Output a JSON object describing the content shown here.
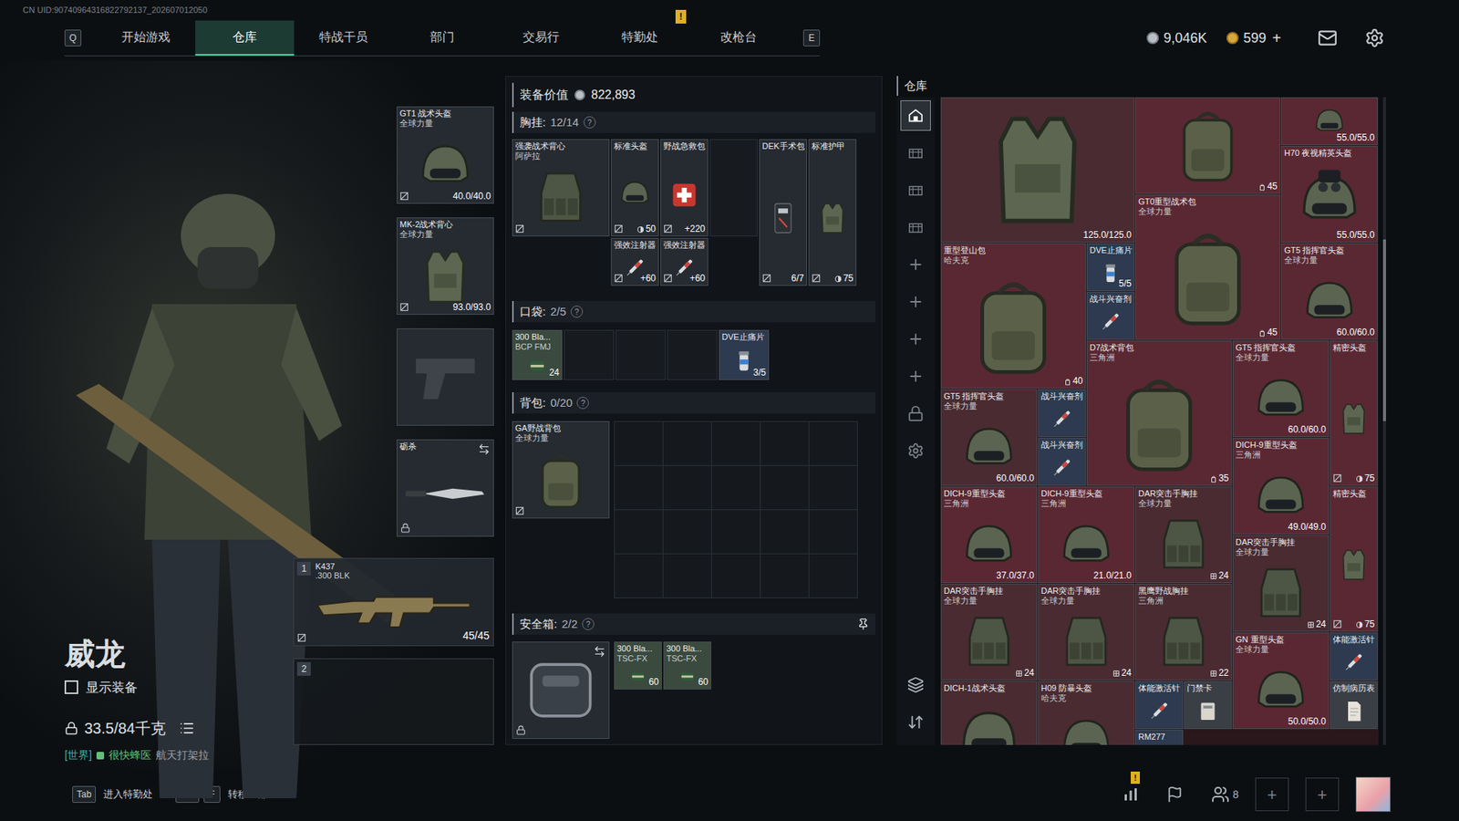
{
  "uid": "CN UID:90740964316822792137_202607012050",
  "nav": {
    "prev_key": "Q",
    "next_key": "E",
    "alert_mark": "!",
    "tabs": [
      {
        "label": "开始游戏",
        "selected": false,
        "alert": false
      },
      {
        "label": "仓库",
        "selected": true,
        "alert": false
      },
      {
        "label": "特战干员",
        "selected": false,
        "alert": false
      },
      {
        "label": "部门",
        "selected": false,
        "alert": false
      },
      {
        "label": "交易行",
        "selected": false,
        "alert": false
      },
      {
        "label": "特勤处",
        "selected": false,
        "alert": true
      },
      {
        "label": "改枪台",
        "selected": false,
        "alert": false
      }
    ]
  },
  "currency": {
    "coins": "9,046K",
    "gold": "599",
    "add": "+"
  },
  "character": {
    "name": "威龙",
    "show_gear": {
      "label": "显示装备",
      "checked": false
    },
    "weight": "33.5/84千克",
    "chat": {
      "channel": "[世界]",
      "user": "很快蜂医",
      "message": "航天打架拉"
    }
  },
  "gear_slots": [
    {
      "kind": "helmet",
      "name": "GT1 战术头盔",
      "faction": "全球力量",
      "value": "40.0/40.0",
      "bound": true,
      "empty": false,
      "locked": false,
      "swappable": false
    },
    {
      "kind": "armor",
      "name": "MK-2战术背心",
      "faction": "全球力量",
      "value": "93.0/93.0",
      "bound": true,
      "empty": false,
      "locked": false,
      "swappable": false
    },
    {
      "kind": "pistol",
      "empty": true,
      "bound": false,
      "locked": false,
      "swappable": false
    },
    {
      "kind": "knife",
      "name": "砺杀",
      "empty": false,
      "bound": false,
      "locked": true,
      "swappable": true
    }
  ],
  "weapons": [
    {
      "slot": "1",
      "name": "K437",
      "caliber": ".300 BLK",
      "ammo": "45/45",
      "bound": true,
      "empty": false
    },
    {
      "slot": "2",
      "empty": true,
      "bound": false
    }
  ],
  "loadout": {
    "value_label": "装备价值",
    "value": "822,893",
    "rig": {
      "title": "胸挂:",
      "count": "12/14",
      "help": "?",
      "container": {
        "kind": "rig",
        "name": "强袭战术背心",
        "faction": "阿萨拉",
        "bound": true
      },
      "items": [
        {
          "kind": "helmet",
          "name": "标准头盔",
          "value": "50",
          "badge": "shield",
          "bound": true
        },
        {
          "kind": "medkit",
          "name": "野战急救包",
          "value": "+220",
          "badge": "none",
          "bound": true
        },
        {
          "kind": "empty"
        },
        {
          "kind": "surgery",
          "name": "DEK手术包",
          "value": "6/7",
          "badge": "none",
          "bound": true
        },
        {
          "kind": "armor",
          "name": "标准护甲",
          "value": "75",
          "badge": "shield",
          "bound": true
        },
        {
          "kind": "stim",
          "name": "强效注射器",
          "value": "+60",
          "badge": "none",
          "bound": true
        },
        {
          "kind": "stim",
          "name": "强效注射器",
          "value": "+60",
          "badge": "none",
          "bound": true
        }
      ]
    },
    "pockets": {
      "title": "口袋:",
      "count": "2/5",
      "help": "?",
      "items": [
        {
          "kind": "ammo",
          "name": "300 Bla...",
          "faction": "BCP FMJ",
          "value": "24",
          "badge": "none",
          "bound": false,
          "color": "#3a4a3e"
        },
        {
          "kind": "empty"
        },
        {
          "kind": "empty"
        },
        {
          "kind": "empty"
        },
        {
          "kind": "pill",
          "name": "DVE止痛片",
          "value": "3/5",
          "badge": "none",
          "bound": false,
          "color": "#2d3a4f"
        }
      ]
    },
    "backpack": {
      "title": "背包:",
      "count": "0/20",
      "help": "?",
      "container": {
        "kind": "backpack",
        "name": "GA野战背包",
        "faction": "全球力量",
        "bound": true
      },
      "cells": 20
    },
    "safe": {
      "title": "安全箱:",
      "count": "2/2",
      "help": "?",
      "pinned": true,
      "container": {
        "kind": "safe",
        "locked": true,
        "swappable": true
      },
      "items": [
        {
          "kind": "ammo",
          "name": "300 Bla...",
          "faction": "TSC-FX",
          "value": "60",
          "badge": "none",
          "bound": false,
          "color": "#3a4a3e"
        },
        {
          "kind": "ammo",
          "name": "300 Bla...",
          "faction": "TSC-FX",
          "value": "60",
          "badge": "none",
          "bound": false,
          "color": "#3a4a3e"
        }
      ]
    }
  },
  "warehouse": {
    "title": "仓库",
    "sidebar": [
      {
        "kind": "home",
        "selected": true
      },
      {
        "kind": "box",
        "selected": false
      },
      {
        "kind": "box",
        "selected": false
      },
      {
        "kind": "box",
        "selected": false
      },
      {
        "kind": "add",
        "selected": false
      },
      {
        "kind": "add",
        "selected": false
      },
      {
        "kind": "add",
        "selected": false
      },
      {
        "kind": "add",
        "selected": false
      },
      {
        "kind": "lock",
        "selected": false
      },
      {
        "kind": "settings",
        "selected": false
      }
    ],
    "tools": [
      {
        "kind": "layers"
      },
      {
        "kind": "sort"
      }
    ],
    "scroll": {
      "offset": 0.22,
      "size": 0.28
    },
    "items": [
      {
        "kind": "armor",
        "value": "125.0/125.0",
        "badge": "none",
        "bound": false,
        "color": "#4a2b31"
      },
      {
        "kind": "backpack",
        "value": "45",
        "badge": "bag",
        "bound": false,
        "color": "#5a2832"
      },
      {
        "kind": "helmet",
        "value": "55.0/55.0",
        "badge": "none",
        "bound": false,
        "color": "#5a2832"
      },
      {
        "kind": "nvg",
        "name": "H70 夜视精英头盔",
        "value": "55.0/55.0",
        "badge": "none",
        "bound": false,
        "color": "#5a2832"
      },
      {
        "kind": "backpack",
        "name": "GT0重型战术包",
        "faction": "全球力量",
        "value": "45",
        "badge": "bag",
        "bound": false,
        "color": "#5a2832"
      },
      {
        "kind": "backpack",
        "name": "重型登山包",
        "faction": "哈夫克",
        "value": "40",
        "badge": "bag",
        "bound": false,
        "color": "#5a2832"
      },
      {
        "kind": "pill",
        "name": "DVE止痛片",
        "value": "5/5",
        "badge": "none",
        "bound": false,
        "color": "#2d3a4f"
      },
      {
        "kind": "stim",
        "name": "战斗兴奋剂",
        "bound": false,
        "color": "#2d3a4f"
      },
      {
        "kind": "helmet",
        "name": "GT5 指挥官头盔",
        "faction": "全球力量",
        "value": "60.0/60.0",
        "badge": "none",
        "bound": false,
        "color": "#5a2832"
      },
      {
        "kind": "backpack",
        "name": "D7战术背包",
        "faction": "三角洲",
        "value": "35",
        "badge": "bag",
        "bound": false,
        "color": "#5a2832"
      },
      {
        "kind": "helmet",
        "name": "GT5 指挥官头盔",
        "faction": "全球力量",
        "value": "60.0/60.0",
        "badge": "none",
        "bound": false,
        "color": "#5a2832"
      },
      {
        "kind": "armor",
        "name": "精密头盔",
        "value": "75",
        "badge": "shield",
        "bound": true,
        "color": "#5a2832"
      },
      {
        "kind": "helmet",
        "name": "GT5 指挥官头盔",
        "faction": "全球力量",
        "value": "60.0/60.0",
        "badge": "none",
        "bound": false,
        "color": "#4a2b31"
      },
      {
        "kind": "stim",
        "name": "战斗兴奋剂",
        "bound": false,
        "color": "#2d3a4f"
      },
      {
        "kind": "stim",
        "name": "战斗兴奋剂",
        "bound": false,
        "color": "#2d3a4f"
      },
      {
        "kind": "helmet",
        "name": "DICH-9重型头盔",
        "faction": "三角洲",
        "value": "49.0/49.0",
        "badge": "none",
        "bound": false,
        "color": "#5a2832"
      },
      {
        "kind": "helmet",
        "name": "DICH-9重型头盔",
        "faction": "三角洲",
        "value": "37.0/37.0",
        "badge": "none",
        "bound": false,
        "color": "#5a2832"
      },
      {
        "kind": "helmet",
        "name": "DICH-9重型头盔",
        "faction": "三角洲",
        "value": "21.0/21.0",
        "badge": "none",
        "bound": false,
        "color": "#5a2832"
      },
      {
        "kind": "rig",
        "name": "DAR突击手胸挂",
        "faction": "全球力量",
        "value": "24",
        "badge": "grid",
        "bound": false,
        "color": "#4a2b31"
      },
      {
        "kind": "armor",
        "name": "精密头盔",
        "value": "75",
        "badge": "shield",
        "bound": true,
        "color": "#5a2832"
      },
      {
        "kind": "rig",
        "name": "DAR突击手胸挂",
        "faction": "全球力量",
        "value": "24",
        "badge": "grid",
        "bound": false,
        "color": "#4a2b31"
      },
      {
        "kind": "rig",
        "name": "DAR突击手胸挂",
        "faction": "全球力量",
        "value": "24",
        "badge": "grid",
        "bound": false,
        "color": "#4a2b31"
      },
      {
        "kind": "rig",
        "name": "DAR突击手胸挂",
        "faction": "全球力量",
        "value": "24",
        "badge": "grid",
        "bound": false,
        "color": "#4a2b31"
      },
      {
        "kind": "rig",
        "name": "黑鹰野战胸挂",
        "faction": "三角洲",
        "value": "22",
        "badge": "grid",
        "bound": false,
        "color": "#4a2b31"
      },
      {
        "kind": "helmet",
        "name": "GN 重型头盔",
        "faction": "全球力量",
        "value": "50.0/50.0",
        "badge": "none",
        "bound": false,
        "color": "#5a2832"
      },
      {
        "kind": "stim",
        "name": "体能激活针",
        "bound": false,
        "color": "#2d3a4f"
      },
      {
        "kind": "helmet",
        "name": "DICH-1战术头盔",
        "bound": false,
        "color": "#4a2b31"
      },
      {
        "kind": "helmet",
        "name": "H09 防暴头盔",
        "faction": "哈夫克",
        "bound": false,
        "color": "#4a2b31"
      },
      {
        "kind": "stim",
        "name": "体能激活针",
        "bound": false,
        "color": "#2d3a4f"
      },
      {
        "kind": "ammo",
        "name": "RM277",
        "bound": false,
        "color": "#2d3a4f"
      },
      {
        "kind": "card",
        "name": "门禁卡",
        "bound": false,
        "color": "#3a3e45"
      },
      {
        "kind": "doc",
        "name": "仿制病历表",
        "bound": false,
        "color": "#3a3e45"
      }
    ]
  },
  "bottom_bar": {
    "hints": [
      {
        "keys": [
          "Tab"
        ],
        "label": "进入特勤处"
      },
      {
        "keys": [
          "Ctrl",
          "F"
        ],
        "label": "转移全部"
      }
    ],
    "alert_mark": "!",
    "tools": [
      {
        "kind": "stats",
        "alert": true
      },
      {
        "kind": "flag",
        "alert": false
      }
    ],
    "friends": "8",
    "slots": [
      "+",
      "+"
    ]
  }
}
